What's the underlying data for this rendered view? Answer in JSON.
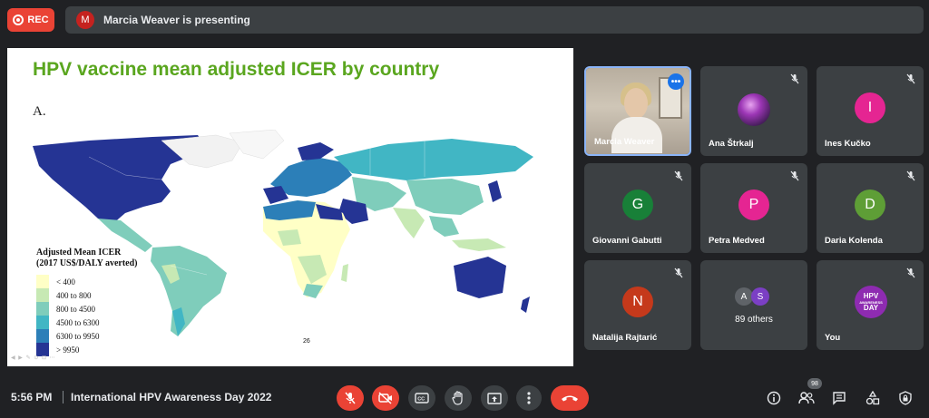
{
  "recording": {
    "label": "REC",
    "color": "#ea4335"
  },
  "presenting_bar": {
    "avatar_initial": "M",
    "text": "Marcia Weaver is presenting"
  },
  "slide": {
    "title": "HPV vaccine mean adjusted ICER by country",
    "panel_label": "A.",
    "legend_title_1": "Adjusted Mean ICER",
    "legend_title_2": "(2017 US$/DALY averted)",
    "legend": [
      {
        "label": "< 400",
        "color": "#ffffc6"
      },
      {
        "label": "400 to 800",
        "color": "#c7e9b4"
      },
      {
        "label": "800 to 4500",
        "color": "#7fcdbb"
      },
      {
        "label": "4500 to 6300",
        "color": "#41b6c4"
      },
      {
        "label": "6300 to 9950",
        "color": "#2c7fb8"
      },
      {
        "label": "> 9950",
        "color": "#253494"
      }
    ],
    "page_number": "26"
  },
  "participants": [
    {
      "name": "Marcia Weaver",
      "type": "video",
      "active": true
    },
    {
      "name": "Ana Štrkalj",
      "type": "photo",
      "muted": true
    },
    {
      "name": "Ines Kučko",
      "initial": "I",
      "color": "#e52592",
      "muted": true
    },
    {
      "name": "Giovanni Gabutti",
      "initial": "G",
      "color": "#188038",
      "muted": true
    },
    {
      "name": "Petra Medved",
      "initial": "P",
      "color": "#e52592",
      "muted": true
    },
    {
      "name": "Daria Kolenda",
      "initial": "D",
      "color": "#5e9e36",
      "muted": true
    },
    {
      "name": "Natalija Rajtarić",
      "initial": "N",
      "color": "#c5391b",
      "muted": true
    },
    {
      "name": "89 others",
      "type": "others",
      "initials": [
        "A",
        "S"
      ]
    },
    {
      "name": "You",
      "type": "logo",
      "logo_lines": [
        "HPV",
        "AWARENESS",
        "DAY"
      ],
      "muted": true
    }
  ],
  "footer": {
    "time": "5:56 PM",
    "meeting_title": "International HPV Awareness Day 2022",
    "people_count": "98"
  },
  "controls": {
    "mic": "mic-off-icon",
    "camera": "camera-off-icon",
    "captions": "closed-captions-icon",
    "raise_hand": "raise-hand-icon",
    "present": "present-screen-icon",
    "more": "more-options-icon",
    "leave": "leave-call-icon"
  }
}
